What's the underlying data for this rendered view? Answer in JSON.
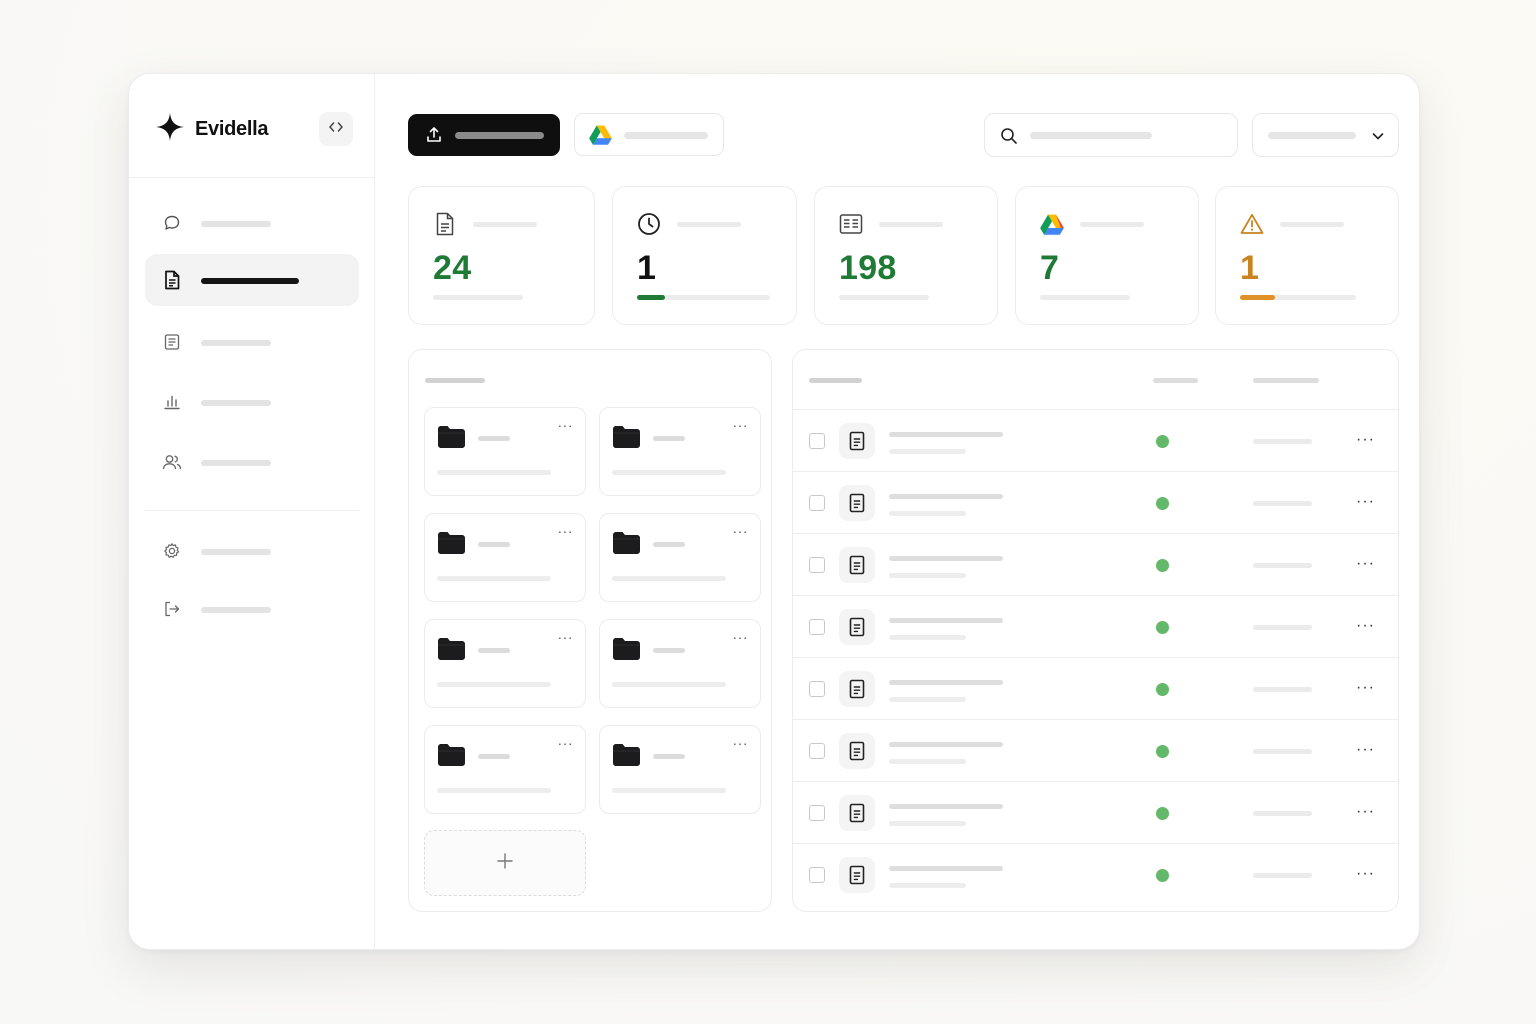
{
  "app": {
    "name": "Evidella",
    "collapse_icon": "code-brackets-icon"
  },
  "sidebar": {
    "items": [
      {
        "label": "",
        "icon": "chat-icon",
        "active": false
      },
      {
        "label": "",
        "icon": "document-icon",
        "active": true
      },
      {
        "label": "",
        "icon": "report-icon",
        "active": false
      },
      {
        "label": "",
        "icon": "bar-chart-icon",
        "active": false
      },
      {
        "label": "",
        "icon": "users-icon",
        "active": false
      }
    ],
    "footer_items": [
      {
        "label": "",
        "icon": "gear-icon"
      },
      {
        "label": "",
        "icon": "logout-icon"
      }
    ]
  },
  "toolbar": {
    "upload_label": "",
    "upload_icon": "upload-icon",
    "drive_label": "",
    "drive_icon": "google-drive-icon",
    "search_placeholder": "",
    "filter_value": ""
  },
  "stats": [
    {
      "value": "24",
      "label": "",
      "icon": "document-icon",
      "color": "#1f7a35",
      "progress": null
    },
    {
      "value": "1",
      "label": "",
      "icon": "clock-icon",
      "color": "#111111",
      "progress": 0.21,
      "progress_color": "#1f7a35"
    },
    {
      "value": "198",
      "label": "",
      "icon": "text-block-icon",
      "color": "#1f7a35",
      "progress": null
    },
    {
      "value": "7",
      "label": "",
      "icon": "google-drive-icon",
      "color": "#1f7a35",
      "progress": null
    },
    {
      "value": "1",
      "label": "",
      "icon": "warning-icon",
      "color": "#c8841f",
      "progress": 0.3,
      "progress_color": "#e0912a"
    }
  ],
  "folders": {
    "title": "",
    "items": [
      {
        "name": "",
        "meta": ""
      },
      {
        "name": "",
        "meta": ""
      },
      {
        "name": "",
        "meta": ""
      },
      {
        "name": "",
        "meta": ""
      },
      {
        "name": "",
        "meta": ""
      },
      {
        "name": "",
        "meta": ""
      },
      {
        "name": "",
        "meta": ""
      },
      {
        "name": "",
        "meta": ""
      }
    ],
    "add_label": "+"
  },
  "files": {
    "columns": [
      "",
      "",
      ""
    ],
    "rows": [
      {
        "name": "",
        "sub": "",
        "status": "ok",
        "date": ""
      },
      {
        "name": "",
        "sub": "",
        "status": "ok",
        "date": ""
      },
      {
        "name": "",
        "sub": "",
        "status": "ok",
        "date": ""
      },
      {
        "name": "",
        "sub": "",
        "status": "ok",
        "date": ""
      },
      {
        "name": "",
        "sub": "",
        "status": "ok",
        "date": ""
      },
      {
        "name": "",
        "sub": "",
        "status": "ok",
        "date": ""
      },
      {
        "name": "",
        "sub": "",
        "status": "ok",
        "date": ""
      },
      {
        "name": "",
        "sub": "",
        "status": "ok",
        "date": ""
      }
    ],
    "status_color": "#63b86a",
    "more_label": "···"
  },
  "colors": {
    "accent_green": "#1f7a35",
    "warning_orange": "#c8841f",
    "primary_button": "#0f0f0f"
  }
}
